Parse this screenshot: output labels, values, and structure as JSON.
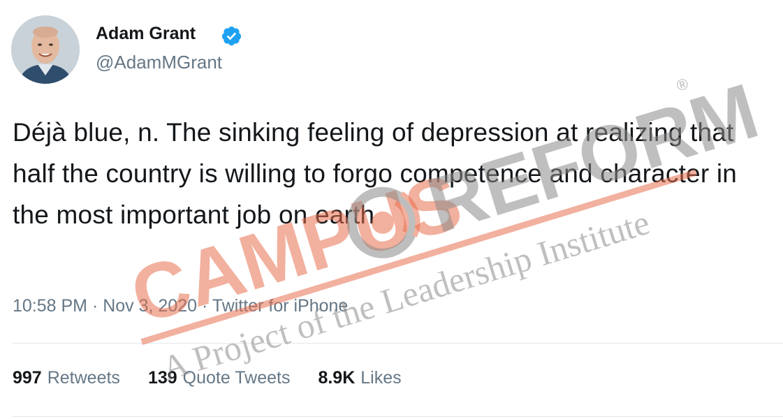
{
  "tweet": {
    "author": {
      "display_name": "Adam Grant",
      "handle": "@AdamMGrant",
      "verified": true
    },
    "text": "Déjà blue, n. The sinking feeling of depression at realizing that half the country is willing to forgo competence and character in the most important job on earth",
    "timestamp": "10:58 PM · Nov 3, 2020 · Twitter for iPhone",
    "stats": [
      {
        "count": "997",
        "label": "Retweets"
      },
      {
        "count": "139",
        "label": "Quote Tweets"
      },
      {
        "count": "8.9K",
        "label": "Likes"
      }
    ]
  },
  "watermark": {
    "brand_left": "CAMPUS",
    "brand_right": "REFORM",
    "registered_mark": "®",
    "tagline": "A Project of the Leadership Institute",
    "color": "#e8704f"
  },
  "colors": {
    "verified_badge": "#1da1f2",
    "primary_text": "#14171a",
    "secondary_text": "#657786"
  },
  "icons": {
    "verified": "verified-badge-icon"
  }
}
